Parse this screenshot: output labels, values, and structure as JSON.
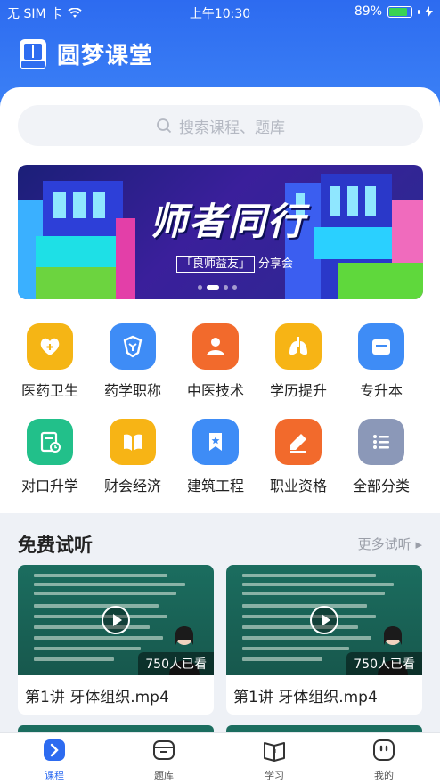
{
  "status_bar": {
    "carrier": "无 SIM 卡",
    "time": "上午10:30",
    "battery": "89%",
    "battery_level": 0.89
  },
  "app": {
    "title": "圆梦课堂",
    "logo_text": "圆梦课堂"
  },
  "search": {
    "placeholder": "搜索课程、题库"
  },
  "banner": {
    "title": "师者同行",
    "subtitle_tag": "「良师益友」",
    "subtitle": "分享会",
    "slide_count": 4,
    "active_slide": 1
  },
  "categories": [
    {
      "label": "医药卫生",
      "icon": "medical-heart-icon",
      "color": "#f5b515"
    },
    {
      "label": "药学职称",
      "icon": "pharmacy-shield-icon",
      "color": "#3e8cf6"
    },
    {
      "label": "中医技术",
      "icon": "doctor-person-icon",
      "color": "#f26a2c"
    },
    {
      "label": "学历提升",
      "icon": "lungs-icon",
      "color": "#f7b415"
    },
    {
      "label": "专升本",
      "icon": "folder-icon",
      "color": "#3e8cf6"
    },
    {
      "label": "对口升学",
      "icon": "document-clock-icon",
      "color": "#22c08a"
    },
    {
      "label": "财会经济",
      "icon": "open-book-icon",
      "color": "#f7b415"
    },
    {
      "label": "建筑工程",
      "icon": "bookmark-star-icon",
      "color": "#3e8cf6"
    },
    {
      "label": "职业资格",
      "icon": "edit-pen-icon",
      "color": "#f26a2c"
    },
    {
      "label": "全部分类",
      "icon": "list-icon",
      "color": "#8b98b8"
    }
  ],
  "free_section": {
    "title": "免费试听",
    "more": "更多试听"
  },
  "videos": [
    {
      "title": "第1讲 牙体组织.mp4",
      "views": "750人已看"
    },
    {
      "title": "第1讲 牙体组织.mp4",
      "views": "750人已看"
    }
  ],
  "tabs": [
    {
      "label": "课程",
      "icon": "course-arrow-icon",
      "active": true
    },
    {
      "label": "题库",
      "icon": "question-bank-icon",
      "active": false
    },
    {
      "label": "学习",
      "icon": "study-book-icon",
      "active": false
    },
    {
      "label": "我的",
      "icon": "profile-face-icon",
      "active": false
    }
  ],
  "colors": {
    "primary": "#2d6bf0",
    "text": "#222222",
    "muted": "#9a9ea8"
  }
}
